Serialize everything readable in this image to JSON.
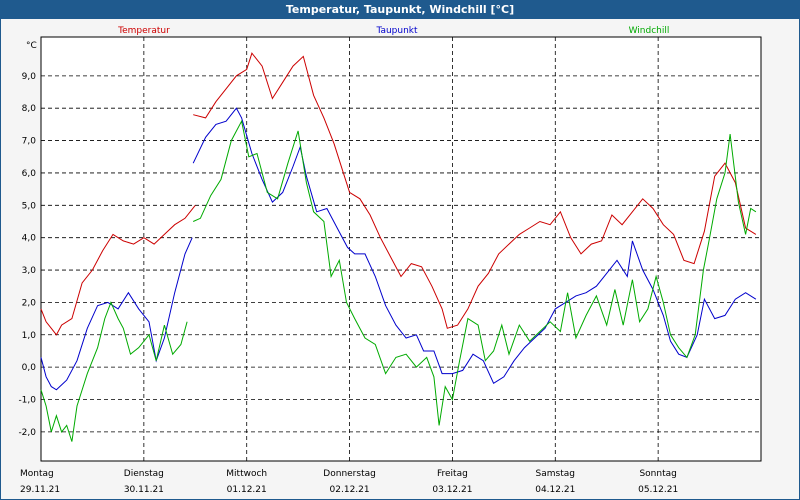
{
  "window": {
    "title": "Temperatur, Taupunkt, Windchill [°C]"
  },
  "chart_data": {
    "type": "line",
    "ylabel": "°C",
    "ylim": [
      -2.9,
      10.2
    ],
    "yticks": [
      -2.0,
      -1.0,
      0.0,
      1.0,
      2.0,
      3.0,
      4.0,
      5.0,
      6.0,
      7.0,
      8.0,
      9.0
    ],
    "ytick_labels": [
      "-2,0",
      "-1,0",
      "0,0",
      "1,0",
      "2,0",
      "3,0",
      "4,0",
      "5,0",
      "6,0",
      "7,0",
      "8,0",
      "9,0"
    ],
    "xlim": [
      0,
      7
    ],
    "x_labels": [
      {
        "day": "Montag",
        "date": "29.11.21"
      },
      {
        "day": "Dienstag",
        "date": "30.11.21"
      },
      {
        "day": "Mittwoch",
        "date": "01.12.21"
      },
      {
        "day": "Donnerstag",
        "date": "02.12.21"
      },
      {
        "day": "Freitag",
        "date": "03.12.21"
      },
      {
        "day": "Samstag",
        "date": "04.12.21"
      },
      {
        "day": "Sonntag",
        "date": "05.12.21"
      }
    ],
    "grid": true,
    "series": [
      {
        "name": "Temperatur",
        "color": "#cc0000",
        "segments": [
          [
            [
              0,
              1.8
            ],
            [
              0.05,
              1.4
            ],
            [
              0.1,
              1.2
            ],
            [
              0.15,
              1.0
            ],
            [
              0.2,
              1.3
            ],
            [
              0.3,
              1.5
            ],
            [
              0.4,
              2.6
            ],
            [
              0.5,
              3.0
            ],
            [
              0.6,
              3.6
            ],
            [
              0.7,
              4.1
            ],
            [
              0.8,
              3.9
            ],
            [
              0.9,
              3.8
            ],
            [
              1.0,
              4.0
            ],
            [
              1.1,
              3.8
            ],
            [
              1.2,
              4.1
            ],
            [
              1.3,
              4.4
            ],
            [
              1.4,
              4.6
            ],
            [
              1.5,
              5.0
            ]
          ],
          [
            [
              1.48,
              7.8
            ],
            [
              1.6,
              7.7
            ],
            [
              1.7,
              8.2
            ],
            [
              1.8,
              8.6
            ],
            [
              1.9,
              9.0
            ],
            [
              2.0,
              9.2
            ],
            [
              2.05,
              9.7
            ],
            [
              2.15,
              9.3
            ],
            [
              2.25,
              8.3
            ],
            [
              2.35,
              8.8
            ],
            [
              2.45,
              9.3
            ],
            [
              2.55,
              9.6
            ],
            [
              2.65,
              8.4
            ],
            [
              2.75,
              7.7
            ],
            [
              2.85,
              6.9
            ],
            [
              2.95,
              5.9
            ],
            [
              3.0,
              5.4
            ],
            [
              3.1,
              5.2
            ],
            [
              3.2,
              4.7
            ],
            [
              3.3,
              4.0
            ],
            [
              3.4,
              3.4
            ],
            [
              3.5,
              2.8
            ],
            [
              3.6,
              3.2
            ],
            [
              3.7,
              3.1
            ],
            [
              3.8,
              2.5
            ],
            [
              3.9,
              1.8
            ],
            [
              3.95,
              1.2
            ],
            [
              4.05,
              1.3
            ],
            [
              4.15,
              1.8
            ],
            [
              4.25,
              2.5
            ],
            [
              4.35,
              2.9
            ],
            [
              4.45,
              3.5
            ],
            [
              4.55,
              3.8
            ],
            [
              4.65,
              4.1
            ],
            [
              4.75,
              4.3
            ],
            [
              4.85,
              4.5
            ],
            [
              4.95,
              4.4
            ],
            [
              5.05,
              4.8
            ],
            [
              5.15,
              4.0
            ],
            [
              5.25,
              3.5
            ],
            [
              5.35,
              3.8
            ],
            [
              5.45,
              3.9
            ],
            [
              5.55,
              4.7
            ],
            [
              5.65,
              4.4
            ],
            [
              5.75,
              4.8
            ],
            [
              5.85,
              5.2
            ],
            [
              5.95,
              4.9
            ],
            [
              6.05,
              4.4
            ],
            [
              6.15,
              4.1
            ],
            [
              6.25,
              3.3
            ],
            [
              6.35,
              3.2
            ],
            [
              6.45,
              4.2
            ],
            [
              6.55,
              5.9
            ],
            [
              6.65,
              6.3
            ],
            [
              6.75,
              5.7
            ],
            [
              6.85,
              4.3
            ],
            [
              6.95,
              4.1
            ]
          ]
        ]
      },
      {
        "name": "Taupunkt",
        "color": "#0000cc",
        "segments": [
          [
            [
              0,
              0.3
            ],
            [
              0.05,
              -0.3
            ],
            [
              0.1,
              -0.6
            ],
            [
              0.15,
              -0.7
            ],
            [
              0.25,
              -0.4
            ],
            [
              0.35,
              0.2
            ],
            [
              0.45,
              1.2
            ],
            [
              0.55,
              1.9
            ],
            [
              0.65,
              2.0
            ],
            [
              0.75,
              1.8
            ],
            [
              0.85,
              2.3
            ],
            [
              0.95,
              1.8
            ],
            [
              1.05,
              1.4
            ],
            [
              1.12,
              0.2
            ],
            [
              1.2,
              0.9
            ],
            [
              1.3,
              2.3
            ],
            [
              1.4,
              3.5
            ],
            [
              1.47,
              4.0
            ]
          ],
          [
            [
              1.48,
              6.3
            ],
            [
              1.6,
              7.1
            ],
            [
              1.7,
              7.5
            ],
            [
              1.8,
              7.6
            ],
            [
              1.9,
              8.0
            ],
            [
              1.95,
              7.7
            ],
            [
              2.05,
              6.6
            ],
            [
              2.15,
              5.8
            ],
            [
              2.25,
              5.1
            ],
            [
              2.35,
              5.4
            ],
            [
              2.45,
              6.2
            ],
            [
              2.52,
              6.8
            ],
            [
              2.58,
              5.9
            ],
            [
              2.68,
              4.8
            ],
            [
              2.78,
              4.9
            ],
            [
              2.88,
              4.3
            ],
            [
              2.98,
              3.7
            ],
            [
              3.05,
              3.5
            ],
            [
              3.15,
              3.5
            ],
            [
              3.25,
              2.8
            ],
            [
              3.35,
              1.9
            ],
            [
              3.45,
              1.3
            ],
            [
              3.55,
              0.9
            ],
            [
              3.65,
              1.0
            ],
            [
              3.72,
              0.5
            ],
            [
              3.82,
              0.5
            ],
            [
              3.9,
              -0.2
            ],
            [
              4.0,
              -0.2
            ],
            [
              4.1,
              -0.1
            ],
            [
              4.2,
              0.4
            ],
            [
              4.3,
              0.2
            ],
            [
              4.4,
              -0.5
            ],
            [
              4.5,
              -0.3
            ],
            [
              4.6,
              0.2
            ],
            [
              4.7,
              0.6
            ],
            [
              4.8,
              0.9
            ],
            [
              4.9,
              1.2
            ],
            [
              5.0,
              1.8
            ],
            [
              5.1,
              2.0
            ],
            [
              5.2,
              2.2
            ],
            [
              5.3,
              2.3
            ],
            [
              5.4,
              2.5
            ],
            [
              5.5,
              2.9
            ],
            [
              5.6,
              3.3
            ],
            [
              5.7,
              2.8
            ],
            [
              5.75,
              3.9
            ],
            [
              5.85,
              3.0
            ],
            [
              5.95,
              2.4
            ],
            [
              6.05,
              1.6
            ],
            [
              6.12,
              0.8
            ],
            [
              6.2,
              0.4
            ],
            [
              6.28,
              0.3
            ],
            [
              6.38,
              1.0
            ],
            [
              6.45,
              2.1
            ],
            [
              6.55,
              1.5
            ],
            [
              6.65,
              1.6
            ],
            [
              6.75,
              2.1
            ],
            [
              6.85,
              2.3
            ],
            [
              6.95,
              2.1
            ]
          ]
        ]
      },
      {
        "name": "Windchill",
        "color": "#00aa00",
        "segments": [
          [
            [
              0,
              -0.7
            ],
            [
              0.05,
              -1.2
            ],
            [
              0.1,
              -2.0
            ],
            [
              0.15,
              -1.5
            ],
            [
              0.2,
              -2.0
            ],
            [
              0.25,
              -1.8
            ],
            [
              0.3,
              -2.3
            ],
            [
              0.35,
              -1.2
            ],
            [
              0.45,
              -0.2
            ],
            [
              0.55,
              0.6
            ],
            [
              0.62,
              1.5
            ],
            [
              0.68,
              2.0
            ],
            [
              0.75,
              1.5
            ],
            [
              0.8,
              1.2
            ],
            [
              0.87,
              0.4
            ],
            [
              0.95,
              0.6
            ],
            [
              1.05,
              1.0
            ],
            [
              1.12,
              0.2
            ],
            [
              1.2,
              1.3
            ],
            [
              1.28,
              0.4
            ],
            [
              1.36,
              0.7
            ],
            [
              1.42,
              1.4
            ]
          ],
          [
            [
              1.48,
              4.5
            ],
            [
              1.55,
              4.6
            ],
            [
              1.65,
              5.3
            ],
            [
              1.75,
              5.8
            ],
            [
              1.85,
              7.0
            ],
            [
              1.95,
              7.6
            ],
            [
              2.02,
              6.5
            ],
            [
              2.1,
              6.6
            ],
            [
              2.2,
              5.4
            ],
            [
              2.3,
              5.2
            ],
            [
              2.4,
              6.3
            ],
            [
              2.5,
              7.3
            ],
            [
              2.58,
              5.7
            ],
            [
              2.65,
              4.8
            ],
            [
              2.75,
              4.5
            ],
            [
              2.82,
              2.8
            ],
            [
              2.9,
              3.3
            ],
            [
              2.97,
              2.0
            ],
            [
              3.05,
              1.5
            ],
            [
              3.15,
              0.9
            ],
            [
              3.25,
              0.7
            ],
            [
              3.35,
              -0.2
            ],
            [
              3.45,
              0.3
            ],
            [
              3.55,
              0.4
            ],
            [
              3.65,
              0.0
            ],
            [
              3.75,
              0.3
            ],
            [
              3.82,
              -0.3
            ],
            [
              3.87,
              -1.8
            ],
            [
              3.93,
              -0.6
            ],
            [
              4.0,
              -1.0
            ],
            [
              4.07,
              0.2
            ],
            [
              4.15,
              1.5
            ],
            [
              4.25,
              1.3
            ],
            [
              4.32,
              0.2
            ],
            [
              4.4,
              0.5
            ],
            [
              4.48,
              1.3
            ],
            [
              4.55,
              0.4
            ],
            [
              4.65,
              1.3
            ],
            [
              4.75,
              0.8
            ],
            [
              4.85,
              1.1
            ],
            [
              4.95,
              1.4
            ],
            [
              5.05,
              1.1
            ],
            [
              5.12,
              2.3
            ],
            [
              5.2,
              0.9
            ],
            [
              5.3,
              1.6
            ],
            [
              5.4,
              2.2
            ],
            [
              5.5,
              1.3
            ],
            [
              5.58,
              2.4
            ],
            [
              5.66,
              1.3
            ],
            [
              5.75,
              2.7
            ],
            [
              5.82,
              1.4
            ],
            [
              5.9,
              1.8
            ],
            [
              5.98,
              2.8
            ],
            [
              6.05,
              2.0
            ],
            [
              6.12,
              1.0
            ],
            [
              6.2,
              0.6
            ],
            [
              6.28,
              0.3
            ],
            [
              6.36,
              1.0
            ],
            [
              6.44,
              3.0
            ],
            [
              6.5,
              4.0
            ],
            [
              6.57,
              5.2
            ],
            [
              6.65,
              6.0
            ],
            [
              6.7,
              7.2
            ],
            [
              6.78,
              5.1
            ],
            [
              6.85,
              4.1
            ],
            [
              6.9,
              4.9
            ],
            [
              6.95,
              4.8
            ]
          ]
        ]
      }
    ]
  }
}
